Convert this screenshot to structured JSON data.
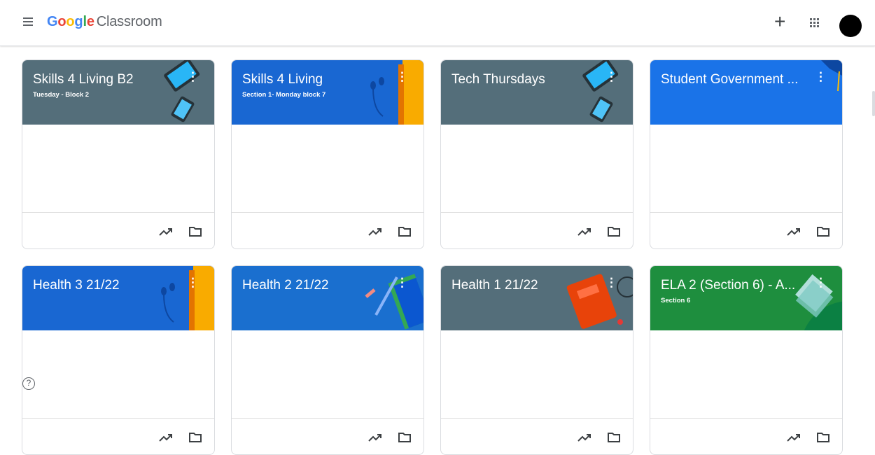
{
  "header": {
    "menu_icon": "hamburger-menu-icon",
    "brand_letters": [
      "G",
      "o",
      "o",
      "g",
      "l",
      "e"
    ],
    "app_name": "Classroom",
    "create_label": "+",
    "apps_icon": "apps-grid-icon",
    "account_icon": "account-avatar"
  },
  "classes": [
    {
      "title": "Skills 4 Living B2",
      "section": "Tuesday - Block 2",
      "color": "#546e7a",
      "art": "tech-tablet"
    },
    {
      "title": "Skills 4 Living",
      "section": "Section 1- Monday block 7",
      "color": "#1967d2",
      "art": "headphones-book"
    },
    {
      "title": "Tech Thursdays",
      "section": "",
      "color": "#546e7a",
      "art": "tech-tablet"
    },
    {
      "title": "Student Government ...",
      "section": "",
      "color": "#1a73e8",
      "art": "graduation"
    },
    {
      "title": "Health 3 21/22",
      "section": "",
      "color": "#1967d2",
      "art": "headphones-book"
    },
    {
      "title": "Health 2 21/22",
      "section": "",
      "color": "#1a6fcf",
      "art": "pencils"
    },
    {
      "title": "Health 1 21/22",
      "section": "",
      "color": "#546e7a",
      "art": "red-book"
    },
    {
      "title": "ELA 2 (Section 6) - A...",
      "section": "Section 6",
      "color": "#1e8e3e",
      "art": "sticky-notes"
    }
  ],
  "card_actions": {
    "gradebook_icon": "trending-up-icon",
    "folder_icon": "folder-icon",
    "more_icon": "more-vert-icon",
    "more_label": "⋮"
  },
  "help": {
    "label": "?",
    "icon": "help-icon"
  }
}
